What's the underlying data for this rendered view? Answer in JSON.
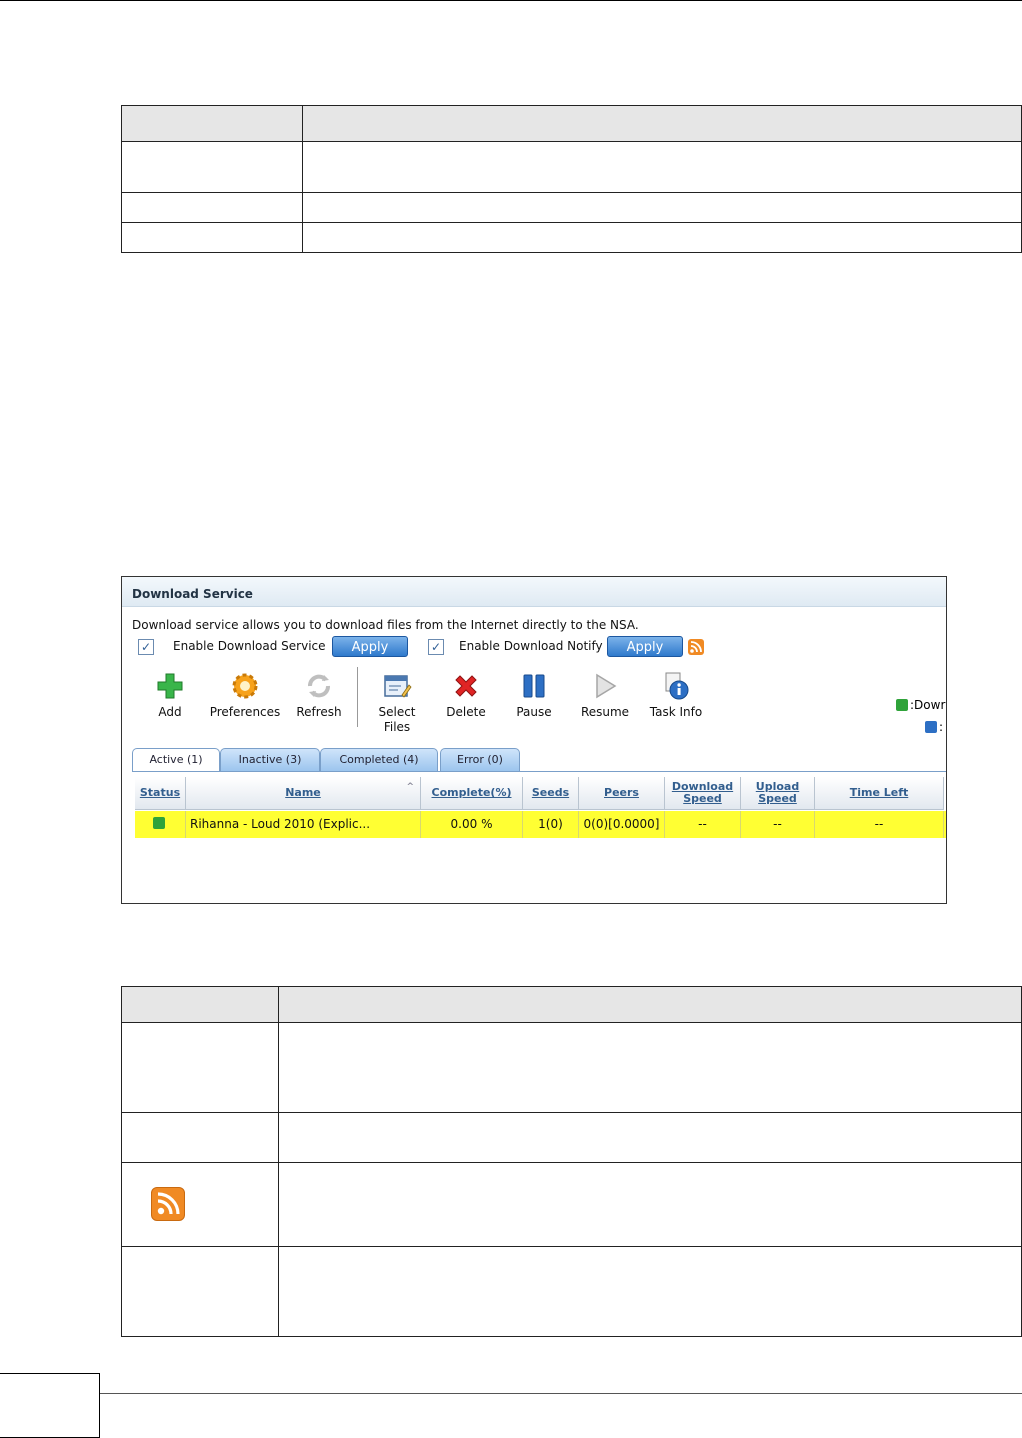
{
  "window": {
    "title": "Download Service",
    "description": "Download service allows you to download files from the Internet directly to the NSA.",
    "enable_download_service": {
      "label": "Enable Download Service",
      "checked": true,
      "apply_label": "Apply"
    },
    "enable_download_notify": {
      "label": "Enable Download Notify",
      "checked": true,
      "apply_label": "Apply"
    },
    "check_mark": "✓",
    "toolbar": [
      {
        "id": "add",
        "label": "Add",
        "icon": "plus-icon"
      },
      {
        "id": "preferences",
        "label": "Preferences",
        "icon": "gear-icon"
      },
      {
        "id": "refresh",
        "label": "Refresh",
        "icon": "refresh-icon"
      },
      {
        "id": "select-files",
        "label": "Select Files",
        "icon": "select-files-icon"
      },
      {
        "id": "delete",
        "label": "Delete",
        "icon": "delete-x-icon"
      },
      {
        "id": "pause",
        "label": "Pause",
        "icon": "pause-icon"
      },
      {
        "id": "resume",
        "label": "Resume",
        "icon": "play-icon"
      },
      {
        "id": "task-info",
        "label": "Task Info",
        "icon": "info-icon"
      }
    ],
    "legend": [
      {
        "icon": "download-status-icon",
        "text": ":Dowr"
      },
      {
        "icon": "upload-status-icon",
        "text": ":"
      }
    ],
    "tabs": [
      {
        "label": "Active (1)",
        "active": true
      },
      {
        "label": "Inactive (3)",
        "active": false
      },
      {
        "label": "Completed (4)",
        "active": false
      },
      {
        "label": "Error (0)",
        "active": false
      }
    ],
    "columns": [
      "Status",
      "Name",
      "Complete(%)",
      "Seeds",
      "Peers",
      "Download Speed",
      "Upload Speed",
      "Time Left"
    ],
    "sort_indicator": "^",
    "rows": [
      {
        "status_icon": "download-status-icon",
        "name": "Rihanna - Loud 2010 (Explic...",
        "complete": "0.00 %",
        "seeds": "1(0)",
        "peers": "0(0)[0.0000]",
        "download_speed": "--",
        "upload_speed": "--",
        "time_left": "--"
      }
    ]
  },
  "colors": {
    "accent": "#2f79cc",
    "row_highlight": "#ffff33",
    "header_text": "#325e8e",
    "rss": "#f08a24"
  }
}
